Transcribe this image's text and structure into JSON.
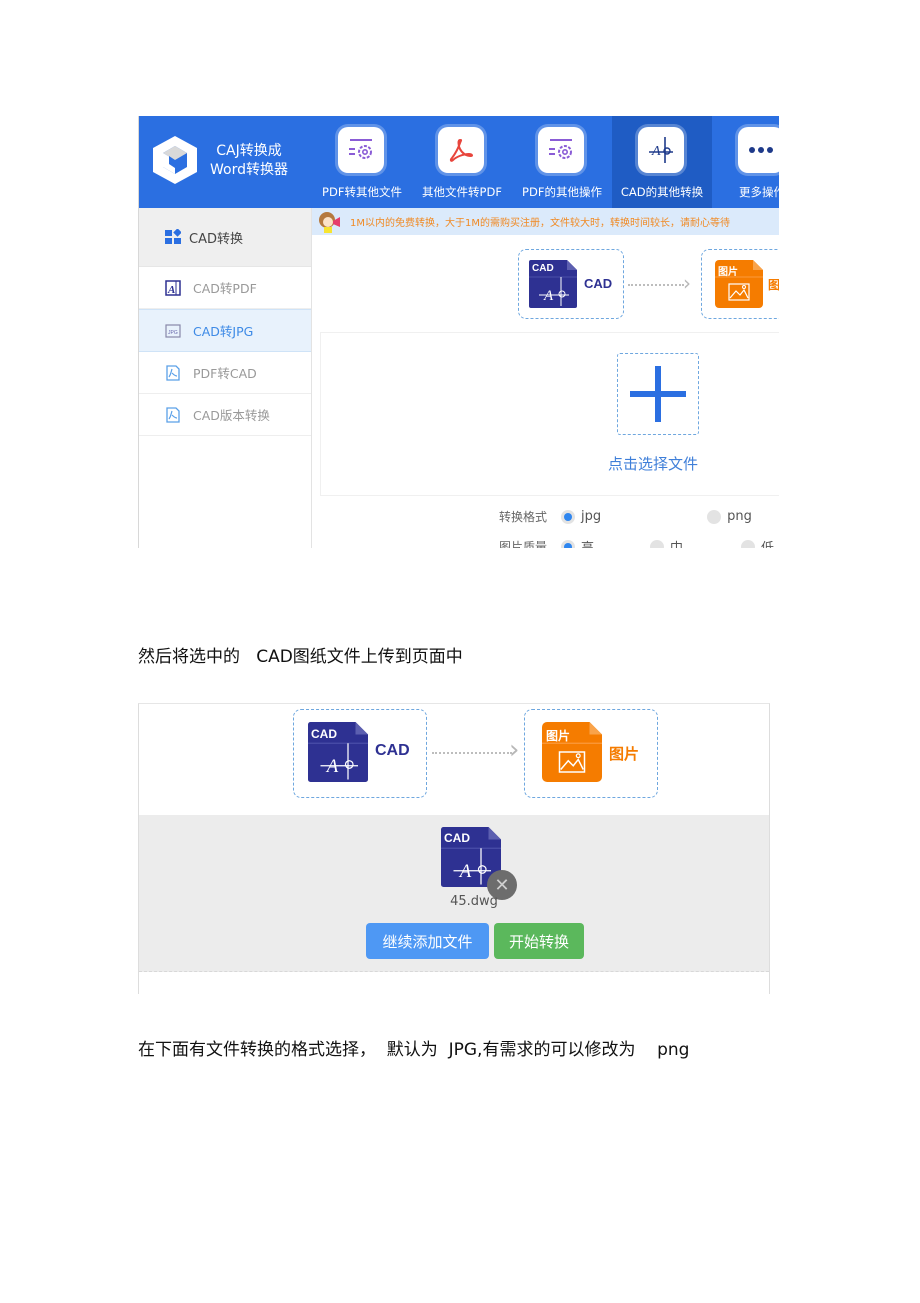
{
  "screenshot1": {
    "app_title_line1": "CAJ转换成",
    "app_title_line2": "Word转换器",
    "nav": [
      {
        "label": "PDF转其他文件",
        "icon": "pdf-settings-icon"
      },
      {
        "label": "其他文件转PDF",
        "icon": "acrobat-icon"
      },
      {
        "label": "PDF的其他操作",
        "icon": "pdf-settings-icon"
      },
      {
        "label": "CAD的其他转换",
        "icon": "cad-icon",
        "active": true
      },
      {
        "label": "更多操作",
        "icon": "more-icon"
      }
    ],
    "sidebar": {
      "header": "CAD转换",
      "items": [
        {
          "label": "CAD转PDF",
          "icon": "cad-pdf-icon"
        },
        {
          "label": "CAD转JPG",
          "icon": "jpg-icon",
          "active": true
        },
        {
          "label": "PDF转CAD",
          "icon": "pdf-file-icon"
        },
        {
          "label": "CAD版本转换",
          "icon": "pdf-file-icon"
        }
      ]
    },
    "notice": "1M以内的免费转换，大于1M的需购买注册，文件较大时，转换时间较长，请耐心等待",
    "source_format": {
      "badge": "CAD",
      "label": "CAD"
    },
    "target_format": {
      "badge": "图片",
      "label": "图片"
    },
    "upload_label": "点击选择文件",
    "options": {
      "format_label": "转换格式",
      "format_choices": [
        "jpg",
        "png"
      ],
      "format_selected": "jpg",
      "quality_label": "图片质量",
      "quality_choices": [
        "高",
        "中",
        "低"
      ],
      "quality_selected": "高"
    }
  },
  "caption1": "然后将选中的   CAD图纸文件上传到页面中",
  "screenshot2": {
    "source_format": {
      "badge": "CAD",
      "label": "CAD"
    },
    "target_format": {
      "badge": "图片",
      "label": "图片"
    },
    "file_badge": "CAD",
    "file_name": "45.dwg",
    "add_more_button": "继续添加文件",
    "start_button": "开始转换"
  },
  "caption2": "在下面有文件转换的格式选择，  默认为  JPG,有需求的可以修改为    png",
  "colors": {
    "brand_blue": "#2b6fe1",
    "cad_navy": "#2e3192",
    "image_orange": "#f57c00",
    "notice_orange": "#f08a24",
    "add_button": "#4e98f4",
    "start_button": "#5bb85c"
  }
}
